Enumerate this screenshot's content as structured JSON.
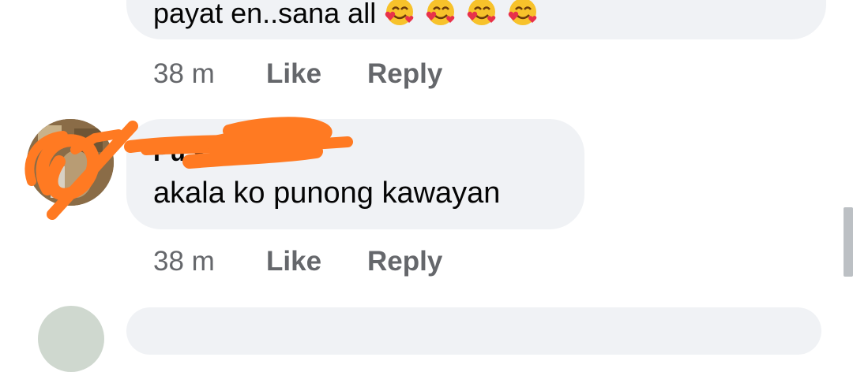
{
  "comments": [
    {
      "text": "payat en..sana all",
      "emoji_icons": [
        "smiling-face-with-hearts-icon",
        "smiling-face-with-hearts-icon",
        "smiling-face-with-hearts-icon",
        "smiling-face-with-hearts-icon"
      ],
      "time": "38 m",
      "like_label": "Like",
      "reply_label": "Reply"
    },
    {
      "author": "Pu        s",
      "text": "akala ko punong kawayan",
      "time": "38 m",
      "like_label": "Like",
      "reply_label": "Reply"
    }
  ],
  "colors": {
    "bubble": "#f0f2f5",
    "action_text": "#65676b",
    "redaction": "#ff7a22"
  }
}
